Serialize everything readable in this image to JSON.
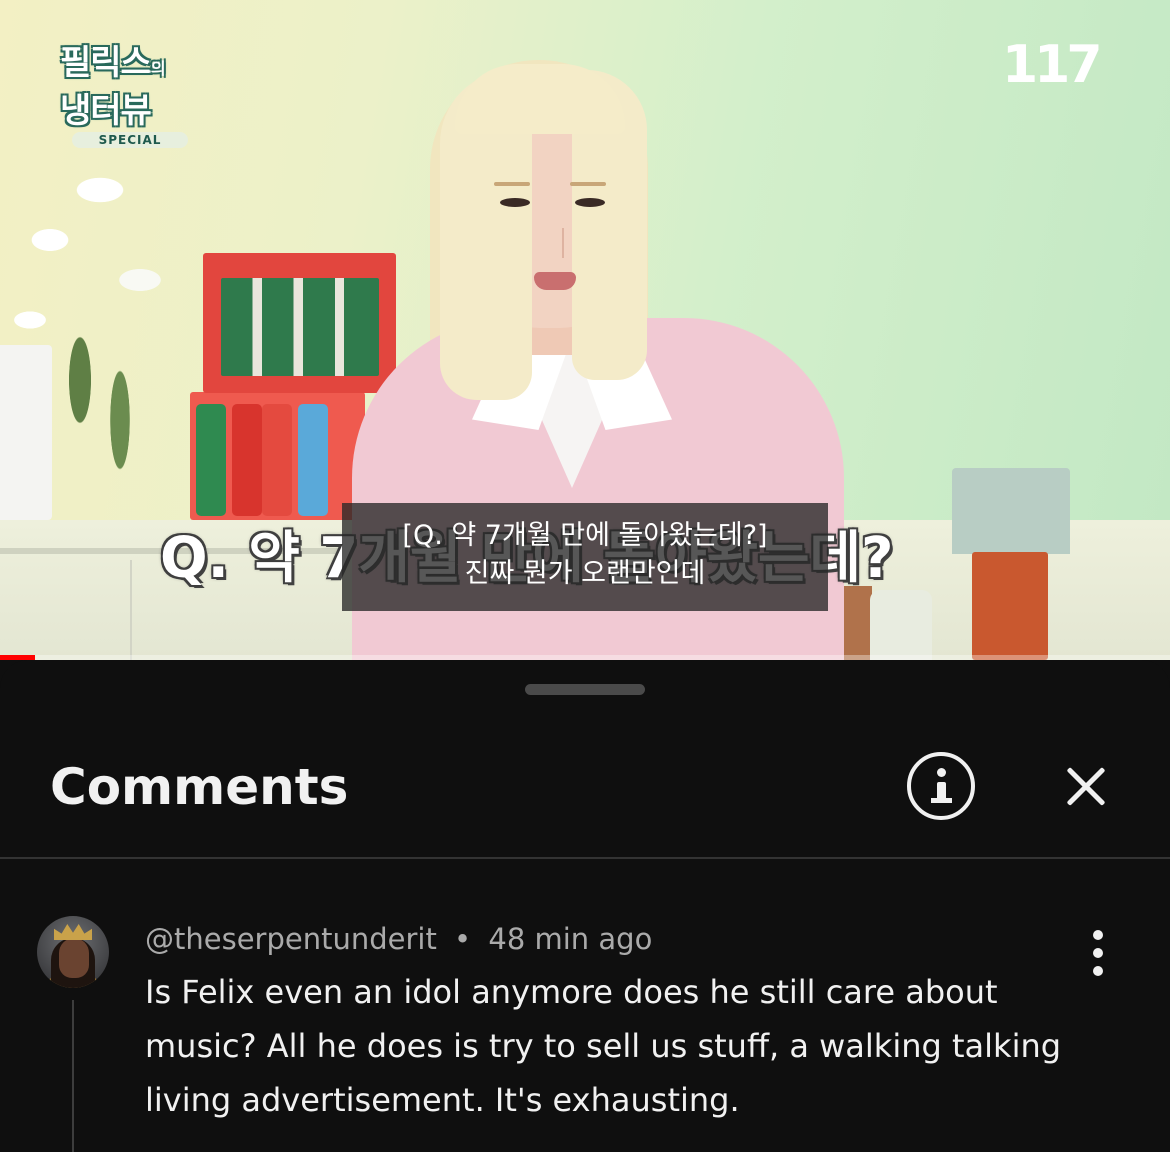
{
  "video": {
    "show_logo": {
      "line1": "필릭스",
      "line1_small": "의",
      "line2": "냉터뷰",
      "special": "SPECIAL"
    },
    "channel_mark": "117",
    "burned_caption": "Q. 약 7개월 만에 돌아왔는데?",
    "closed_captions": [
      "[Q. 약 7개월 만에 돌아왔는데?]",
      "진짜 뭔가 오랜만인데"
    ],
    "progress_fraction": 0.03,
    "progress_color": "#ff0000"
  },
  "comments_panel": {
    "title": "Comments",
    "info_icon": "info-icon",
    "close_icon": "close-icon"
  },
  "comment": {
    "author": "@theserpentunderit",
    "separator": "•",
    "time": "48 min ago",
    "text": "Is Felix even an idol anymore does he still care about music? All he does is try to sell us stuff, a walking talking living advertisement. It's exhausting.",
    "menu_icon": "more-vert-icon"
  }
}
